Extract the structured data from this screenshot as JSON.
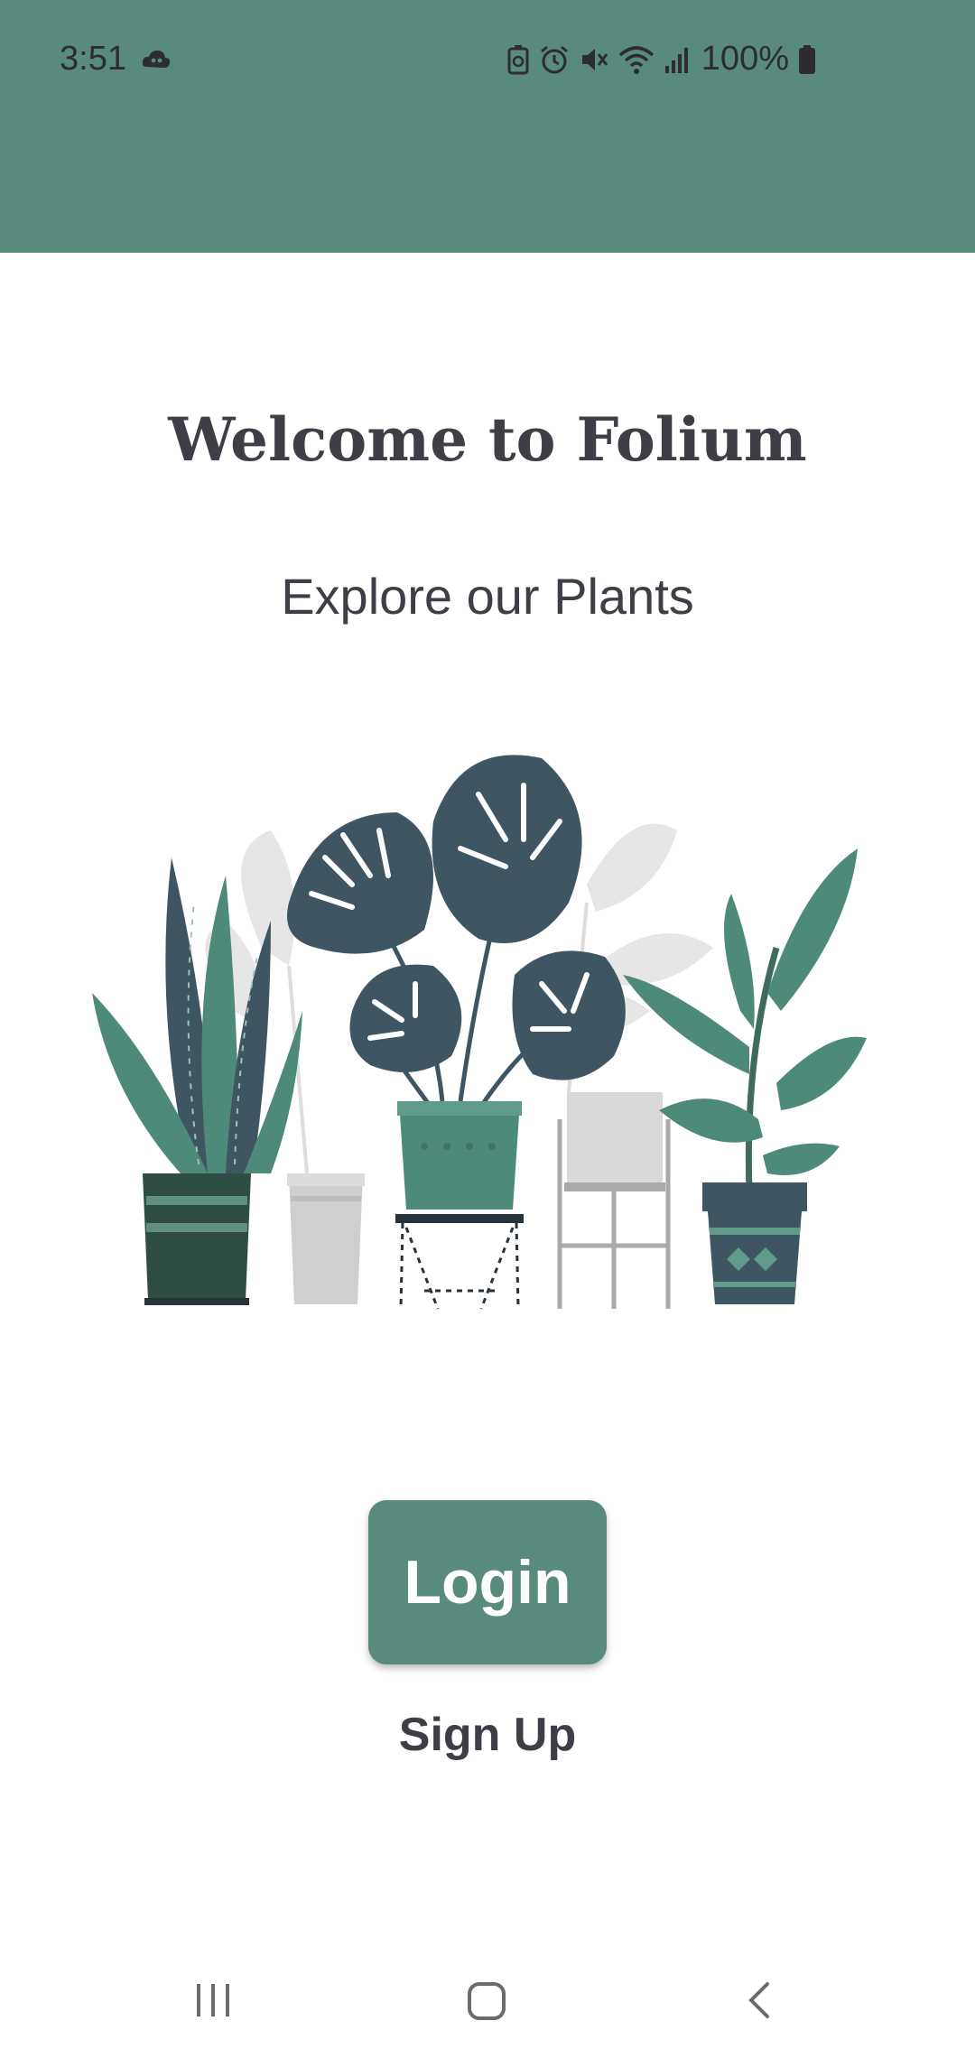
{
  "status_bar": {
    "time": "3:51",
    "battery": "100%",
    "color": "#588b7e",
    "icons": [
      "cloud-game-icon",
      "battery-saver-icon",
      "alarm-icon",
      "mute-icon",
      "wifi-icon",
      "signal-icon",
      "battery-icon"
    ]
  },
  "main": {
    "title": "Welcome to Folium",
    "subtitle": "Explore our Plants",
    "illustration": "potted-plants-illustration"
  },
  "actions": {
    "login_label": "Login",
    "signup_label": "Sign Up"
  },
  "nav_bar": {
    "icons": [
      "recents-icon",
      "home-icon",
      "back-icon"
    ]
  },
  "colors": {
    "accent": "#588b7e",
    "text": "#3f3d45",
    "plant_dark": "#3f5561",
    "plant_green": "#4e8a79"
  }
}
